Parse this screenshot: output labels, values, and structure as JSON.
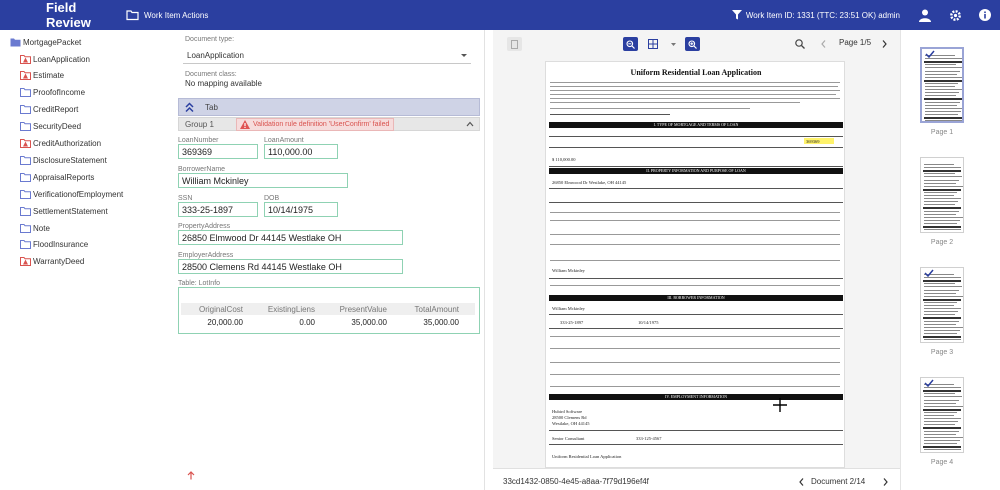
{
  "header": {
    "title": "Field Review",
    "action": "Work Item Actions",
    "work_item": "Work Item ID: 1331 (TTC: 23:51 OK) admin"
  },
  "tree": {
    "root": "MortgagePacket",
    "items": [
      {
        "label": "LoanApplication",
        "flag": true,
        "selected": true
      },
      {
        "label": "Estimate",
        "flag": true
      },
      {
        "label": "ProofofIncome",
        "flag": false
      },
      {
        "label": "CreditReport",
        "flag": false
      },
      {
        "label": "SecurityDeed",
        "flag": false
      },
      {
        "label": "CreditAuthorization",
        "flag": true
      },
      {
        "label": "DisclosureStatement",
        "flag": false
      },
      {
        "label": "AppraisalReports",
        "flag": false
      },
      {
        "label": "VerificationofEmployment",
        "flag": false
      },
      {
        "label": "SettlementStatement",
        "flag": false
      },
      {
        "label": "Note",
        "flag": false
      },
      {
        "label": "FloodInsurance",
        "flag": false
      },
      {
        "label": "WarrantyDeed",
        "flag": true
      }
    ]
  },
  "form": {
    "doc_type_label": "Document type:",
    "doc_type_value": "LoanApplication",
    "doc_class_label": "Document class:",
    "doc_class_value": "No mapping available",
    "tab_label": "Tab",
    "group_label": "Group 1",
    "validation_error": "Validation rule definition 'UserConfirm' failed",
    "fields": {
      "loan_number": {
        "label": "LoanNumber",
        "value": "369369"
      },
      "loan_amount": {
        "label": "LoanAmount",
        "value": "110,000.00"
      },
      "borrower_name": {
        "label": "BorrowerName",
        "value": "William Mckinley"
      },
      "ssn": {
        "label": "SSN",
        "value": "333-25-1897"
      },
      "dob": {
        "label": "DOB",
        "value": "10/14/1975"
      },
      "property_address": {
        "label": "PropertyAddress",
        "value": "26850 Elmwood Dr 44145 Westlake OH"
      },
      "employer_address": {
        "label": "EmployerAddress",
        "value": "28500 Clemens Rd 44145 Westlake OH"
      }
    },
    "table": {
      "label": "Table: LotInfo",
      "headers": [
        "OriginalCost",
        "ExistingLiens",
        "PresentValue",
        "TotalAmount"
      ],
      "row": [
        "20,000.00",
        "0.00",
        "35,000.00",
        "35,000.00"
      ]
    }
  },
  "viewer": {
    "page_indicator": "Page 1/5",
    "doc_id": "33cd1432-0850-4e45-a8aa-7f79d196ef4f",
    "doc_indicator": "Document 2/14",
    "document": {
      "title": "Uniform Residential Loan Application",
      "sections": [
        "I. TYPE OF MORTGAGE AND TERMS OF LOAN",
        "II. PROPERTY INFORMATION AND PURPOSE OF LOAN",
        "III. BORROWER INFORMATION",
        "IV. EMPLOYMENT INFORMATION"
      ],
      "cells": {
        "loan_number": "369369",
        "amount": "$ 110,000.00",
        "property_address": "26850 Elmwood Dr Westlake, OH 44145",
        "borrower_name": "William Mckinley",
        "ssn": "333-25-1897",
        "dob": "10/14/1975",
        "employer": "Hubird Software",
        "employer_address": "28500 Clemens Rd",
        "employer_city": "Westlake, OH 44145",
        "position": "Senior Consultant",
        "phone": "333-125-4567"
      },
      "footer": "Uniform Residential Loan Application"
    }
  },
  "thumbnails": [
    "Page 1",
    "Page 2",
    "Page 3",
    "Page 4"
  ],
  "colors": {
    "header_bg": "#2b3fa0",
    "field_border": "#8fd2b3",
    "error": "#d9534f",
    "tab_bg": "#cfd3e6"
  }
}
